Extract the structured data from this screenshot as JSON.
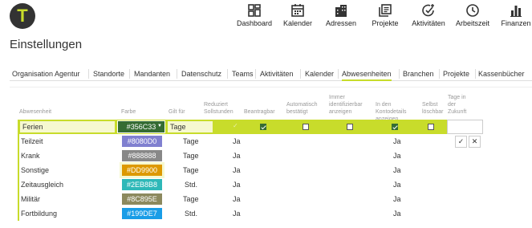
{
  "app": {
    "logo_letter": "T",
    "page_title": "Einstellungen",
    "accent_color": "#c8dc2b",
    "logo_color": "#333333"
  },
  "nav": [
    {
      "label": "Dashboard",
      "icon": "dashboard-icon"
    },
    {
      "label": "Kalender",
      "icon": "calendar-icon"
    },
    {
      "label": "Adressen",
      "icon": "buildings-icon"
    },
    {
      "label": "Projekte",
      "icon": "projects-icon"
    },
    {
      "label": "Aktivitäten",
      "icon": "activity-check-icon"
    },
    {
      "label": "Arbeitszeit",
      "icon": "clock-icon"
    },
    {
      "label": "Finanzen",
      "icon": "bar-chart-icon"
    }
  ],
  "tabs": [
    {
      "label": "Organisation Agentur"
    },
    {
      "label": "Standorte"
    },
    {
      "label": "Mandanten"
    },
    {
      "label": "Datenschutz"
    },
    {
      "label": "Teams"
    },
    {
      "label": "Aktivitäten"
    },
    {
      "label": "Kalender"
    },
    {
      "label": "Abwesenheiten",
      "active": true
    },
    {
      "label": "Branchen"
    },
    {
      "label": "Projekte"
    },
    {
      "label": "Kassenbücher"
    }
  ],
  "table": {
    "columns": [
      {
        "label": "Abwesenheit"
      },
      {
        "label": "Farbe"
      },
      {
        "label": "Gilt für"
      },
      {
        "label": "Reduziert Sollstunden"
      },
      {
        "label": "Beantragbar"
      },
      {
        "label": "Automatisch bestätigt"
      },
      {
        "label": "Immer identifizierbar anzeigen"
      },
      {
        "label": "In den Kontodetails anzeigen"
      },
      {
        "label": "Selbst löschbar"
      },
      {
        "label": "Tage in der Zukunft"
      }
    ],
    "edit_row": {
      "name": "Ferien",
      "color_label": "#356C33",
      "color": "#356C33",
      "gilt_fuer": "Tage",
      "reduziert": true,
      "beantragbar": true,
      "automatisch": false,
      "immer": false,
      "kontodetails": true,
      "selbst": false,
      "tage_zukunft": ""
    },
    "rows": [
      {
        "name": "Teilzeit",
        "color_label": "#8080D0",
        "color": "#8080D0",
        "gilt_fuer": "Tage",
        "reduziert": "Ja",
        "kontodetails": "Ja"
      },
      {
        "name": "Krank",
        "color_label": "#888888",
        "color": "#888888",
        "gilt_fuer": "Tage",
        "reduziert": "Ja",
        "kontodetails": "Ja"
      },
      {
        "name": "Sonstige",
        "color_label": "#DD9900",
        "color": "#DD9900",
        "gilt_fuer": "Tage",
        "reduziert": "Ja",
        "kontodetails": "Ja"
      },
      {
        "name": "Zeitausgleich",
        "color_label": "#2EB8B8",
        "color": "#2EB8B8",
        "gilt_fuer": "Std.",
        "reduziert": "Ja",
        "kontodetails": "Ja"
      },
      {
        "name": "Militär",
        "color_label": "#8C895E",
        "color": "#8C895E",
        "gilt_fuer": "Tage",
        "reduziert": "Ja",
        "kontodetails": "Ja"
      },
      {
        "name": "Fortbildung",
        "color_label": "#199DE7",
        "color": "#199DE7",
        "gilt_fuer": "Std.",
        "reduziert": "Ja",
        "kontodetails": "Ja"
      }
    ],
    "actions": {
      "confirm_icon": "check-icon",
      "cancel_icon": "close-icon"
    }
  }
}
